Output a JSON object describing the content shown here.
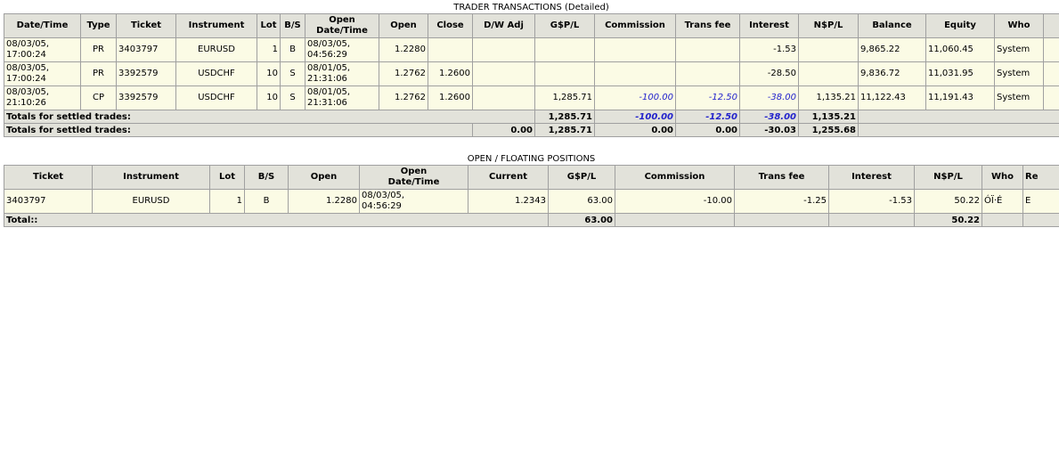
{
  "trader": {
    "caption": "TRADER TRANSACTIONS (Detailed)",
    "headers": [
      "Date/Time",
      "Type",
      "Ticket",
      "Instrument",
      "Lot",
      "B/S",
      "Open\nDate/Time",
      "Open",
      "Close",
      "D/W Adj",
      "G$P/L",
      "Commission",
      "Trans fee",
      "Interest",
      "N$P/L",
      "Balance",
      "Equity",
      "Who"
    ],
    "rows": [
      {
        "date": "08/03/05,\n17:00:24",
        "type": "PR",
        "ticket": "3403797",
        "instrument": "EURUSD",
        "lot": "1",
        "bs": "B",
        "open_dt": "08/03/05,\n04:56:29",
        "open": "1.2280",
        "close": "",
        "dw": "",
        "gpl": "",
        "commission": "",
        "transfee": "",
        "interest": "-1.53",
        "npl": "",
        "balance": "9,865.22",
        "equity": "11,060.45",
        "who": "System"
      },
      {
        "date": "08/03/05,\n17:00:24",
        "type": "PR",
        "ticket": "3392579",
        "instrument": "USDCHF",
        "lot": "10",
        "bs": "S",
        "open_dt": "08/01/05,\n21:31:06",
        "open": "1.2762",
        "close": "1.2600",
        "dw": "",
        "gpl": "",
        "commission": "",
        "transfee": "",
        "interest": "-28.50",
        "npl": "",
        "balance": "9,836.72",
        "equity": "11,031.95",
        "who": "System"
      },
      {
        "date": "08/03/05,\n21:10:26",
        "type": "CP",
        "ticket": "3392579",
        "instrument": "USDCHF",
        "lot": "10",
        "bs": "S",
        "open_dt": "08/01/05,\n21:31:06",
        "open": "1.2762",
        "close": "1.2600",
        "dw": "",
        "gpl": "1,285.71",
        "commission": "-100.00",
        "transfee": "-12.50",
        "interest": "-38.00",
        "npl": "1,135.21",
        "balance": "11,122.43",
        "equity": "11,191.43",
        "who": "System"
      }
    ],
    "totals1": {
      "label": "Totals for settled trades:",
      "gpl": "1,285.71",
      "commission": "-100.00",
      "transfee": "-12.50",
      "interest": "-38.00",
      "npl": "1,135.21"
    },
    "totals2": {
      "label": "Totals for settled trades:",
      "dw": "0.00",
      "gpl": "1,285.71",
      "commission": "0.00",
      "transfee": "0.00",
      "interest": "-30.03",
      "npl": "1,255.68"
    }
  },
  "open": {
    "caption": "OPEN / FLOATING POSITIONS",
    "headers": [
      "Ticket",
      "Instrument",
      "Lot",
      "B/S",
      "Open",
      "Open\nDate/Time",
      "Current",
      "G$P/L",
      "Commission",
      "Trans fee",
      "Interest",
      "N$P/L",
      "Who",
      "Re"
    ],
    "rows": [
      {
        "ticket": "3403797",
        "instrument": "EURUSD",
        "lot": "1",
        "bs": "B",
        "open": "1.2280",
        "open_dt": "08/03/05,\n04:56:29",
        "current": "1.2343",
        "gpl": "63.00",
        "commission": "-10.00",
        "transfee": "-1.25",
        "interest": "-1.53",
        "npl": "50.22",
        "who": "ÓÏ·É",
        "re": "E"
      }
    ],
    "total": {
      "label": "Total::",
      "gpl": "63.00",
      "npl": "50.22"
    }
  },
  "colors": {
    "header_bg": "#e2e2da",
    "cell_bg": "#fbfbe5",
    "border": "#a0a0a0",
    "blue_text": "#2222cc"
  }
}
